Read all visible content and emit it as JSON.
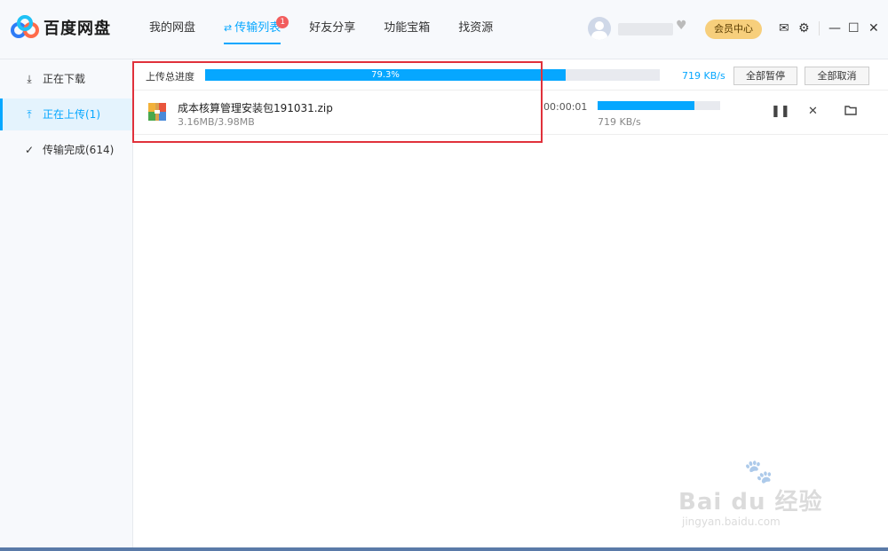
{
  "app": {
    "name": "百度网盘"
  },
  "nav": [
    {
      "label": "我的网盘"
    },
    {
      "label": "传输列表",
      "badge": "1",
      "active": true
    },
    {
      "label": "好友分享"
    },
    {
      "label": "功能宝箱"
    },
    {
      "label": "找资源"
    }
  ],
  "header": {
    "vip_label": "会员中心"
  },
  "sidebar": {
    "items": [
      {
        "label": "正在下载",
        "icon": "download-icon"
      },
      {
        "label": "正在上传(1)",
        "icon": "upload-icon",
        "active": true
      },
      {
        "label": "传输完成(614)",
        "icon": "check-circle-icon"
      }
    ]
  },
  "upload": {
    "total_label": "上传总进度",
    "total_percent_text": "79.3%",
    "total_percent": 79.3,
    "speed": "719 KB/s",
    "pause_all": "全部暂停",
    "cancel_all": "全部取消"
  },
  "files": [
    {
      "name": "成本核算管理安装包191031.zip",
      "size": "3.16MB/3.98MB",
      "time": "00:00:01",
      "progress": 0.79,
      "speed": "719 KB/s",
      "icon": "zip-archive-icon"
    }
  ],
  "watermark": {
    "text": "Bai du 经验",
    "url": "jingyan.baidu.com"
  },
  "colors": {
    "accent": "#06a7ff",
    "highlight": "#e0313b",
    "vip": "#f7cf7c"
  }
}
